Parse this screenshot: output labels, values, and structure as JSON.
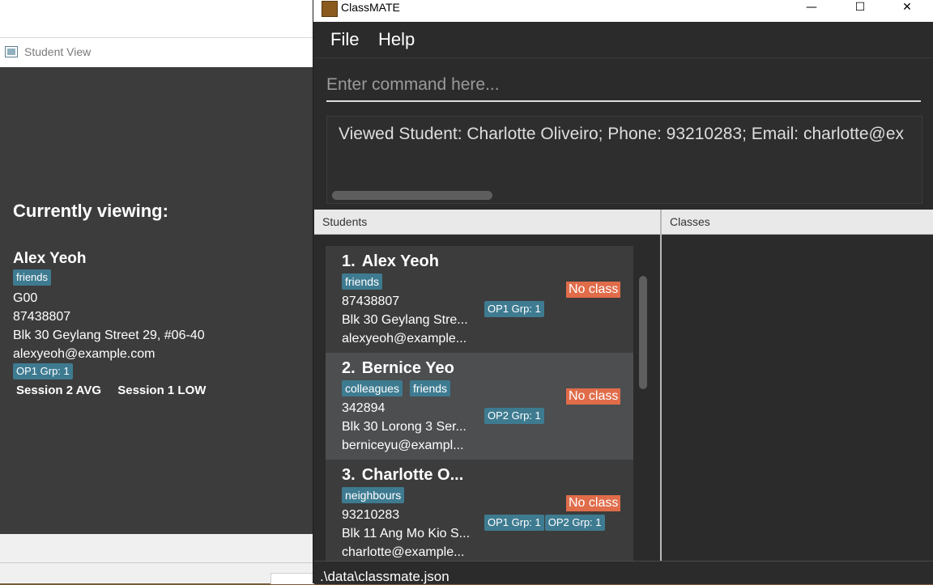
{
  "student_view": {
    "window_title": "Student View",
    "heading": "Currently viewing:",
    "name": "Alex Yeoh",
    "tag": "friends",
    "class_code": "G00",
    "phone": "87438807",
    "address": "Blk 30 Geylang Street 29, #06-40",
    "email": "alexyeoh@example.com",
    "group": "OP1 Grp: 1",
    "sessions": [
      "Session 2 AVG",
      "Session 1 LOW"
    ]
  },
  "app": {
    "window_title": "ClassMATE",
    "window_controls": {
      "minimize": "—",
      "maximize": "☐",
      "close": "✕"
    },
    "menu": {
      "file": "File",
      "help": "Help"
    },
    "command": {
      "placeholder": "Enter command here...",
      "value": ""
    },
    "result": "Viewed Student: Charlotte Oliveiro; Phone: 93210283; Email: charlotte@ex",
    "panels": {
      "students": "Students",
      "classes": "Classes"
    },
    "status_bar": ".\\data\\classmate.json",
    "colors": {
      "tag": "#3e7b91",
      "no_class": "#e06c4a",
      "background": "#2b2b2b"
    }
  },
  "students": [
    {
      "index": "1.",
      "name": "Alex Yeoh",
      "tags": [
        "friends"
      ],
      "phone": "87438807",
      "address": "Blk 30 Geylang Stre...",
      "email": "alexyeoh@example...",
      "groups": [
        "OP1 Grp: 1"
      ],
      "class_status": "No class"
    },
    {
      "index": "2.",
      "name": "Bernice Yeo",
      "tags": [
        "colleagues",
        "friends"
      ],
      "phone": "342894",
      "address": "Blk 30 Lorong 3 Ser...",
      "email": "berniceyu@exampl...",
      "groups": [
        "OP2 Grp: 1"
      ],
      "class_status": "No class"
    },
    {
      "index": "3.",
      "name": "Charlotte O...",
      "tags": [
        "neighbours"
      ],
      "phone": "93210283",
      "address": "Blk 11 Ang Mo Kio S...",
      "email": "charlotte@example...",
      "groups": [
        "OP1 Grp: 1",
        "OP2 Grp: 1"
      ],
      "class_status": "No class"
    }
  ]
}
